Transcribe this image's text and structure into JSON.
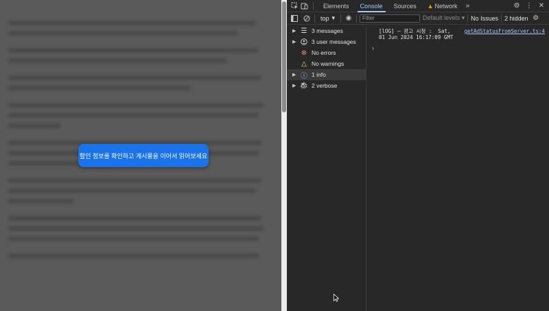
{
  "page": {
    "cta_label": "할인 정보를 확인하고 게시물을 이어서 읽어보세요"
  },
  "devtools": {
    "tabs": [
      "Elements",
      "Console",
      "Sources",
      "Network"
    ],
    "active_tab": "Console",
    "toolbar": {
      "context": "top",
      "filter_placeholder": "Filter",
      "levels": "Default levels",
      "issues": "No Issues",
      "hidden": "2 hidden"
    },
    "sidebar": [
      {
        "label": "3 messages",
        "icon": "list-icon"
      },
      {
        "label": "3 user messages",
        "icon": "user-icon"
      },
      {
        "label": "No errors",
        "icon": "error-icon"
      },
      {
        "label": "No warnings",
        "icon": "warning-icon"
      },
      {
        "label": "1 info",
        "icon": "info-icon"
      },
      {
        "label": "2 verbose",
        "icon": "bug-icon"
      }
    ],
    "log": {
      "line1": "[lOG] – 광고 시청 :  Sat,",
      "line2": "01 Jun 2024 16:17:09 GMT",
      "source": "getAdStatusFromServer.ts:4"
    }
  },
  "colors": {
    "accent": "#a8c7fa",
    "cta": "#1a73e8",
    "warning": "#f29900"
  }
}
